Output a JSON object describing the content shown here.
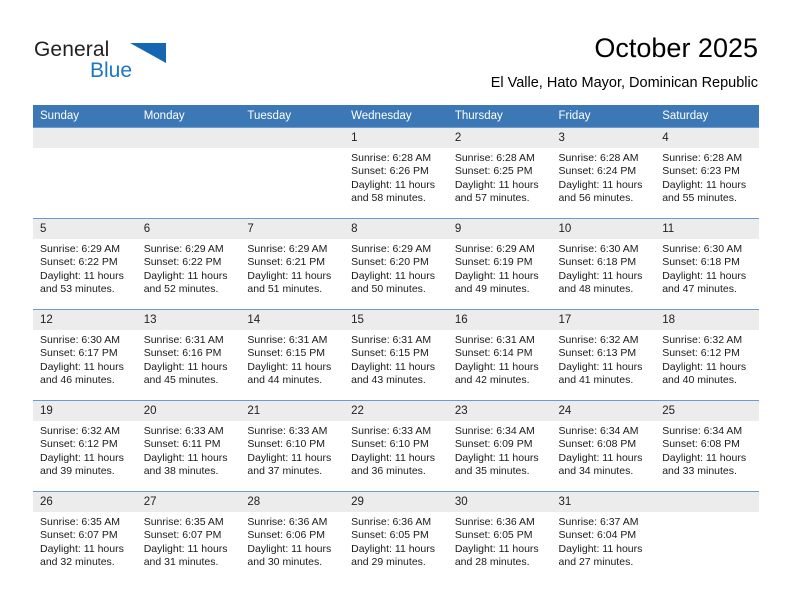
{
  "brand": {
    "name_part1": "General",
    "name_part2": "Blue"
  },
  "header": {
    "title": "October 2025",
    "subtitle": "El Valle, Hato Mayor, Dominican Republic"
  },
  "colors": {
    "header_blue": "#3b78b5",
    "brand_blue": "#1d76c4",
    "day_band": "#ececec",
    "row_rule": "#6b9bd0"
  },
  "weekday_headers": [
    "Sunday",
    "Monday",
    "Tuesday",
    "Wednesday",
    "Thursday",
    "Friday",
    "Saturday"
  ],
  "labels": {
    "sunrise_prefix": "Sunrise:",
    "sunset_prefix": "Sunset:",
    "daylight_prefix": "Daylight:"
  },
  "weeks": [
    [
      {
        "day": "",
        "empty": true
      },
      {
        "day": "",
        "empty": true
      },
      {
        "day": "",
        "empty": true
      },
      {
        "day": "1",
        "sunrise": "Sunrise: 6:28 AM",
        "sunset": "Sunset: 6:26 PM",
        "daylight_1": "Daylight: 11 hours",
        "daylight_2": "and 58 minutes."
      },
      {
        "day": "2",
        "sunrise": "Sunrise: 6:28 AM",
        "sunset": "Sunset: 6:25 PM",
        "daylight_1": "Daylight: 11 hours",
        "daylight_2": "and 57 minutes."
      },
      {
        "day": "3",
        "sunrise": "Sunrise: 6:28 AM",
        "sunset": "Sunset: 6:24 PM",
        "daylight_1": "Daylight: 11 hours",
        "daylight_2": "and 56 minutes."
      },
      {
        "day": "4",
        "sunrise": "Sunrise: 6:28 AM",
        "sunset": "Sunset: 6:23 PM",
        "daylight_1": "Daylight: 11 hours",
        "daylight_2": "and 55 minutes."
      }
    ],
    [
      {
        "day": "5",
        "sunrise": "Sunrise: 6:29 AM",
        "sunset": "Sunset: 6:22 PM",
        "daylight_1": "Daylight: 11 hours",
        "daylight_2": "and 53 minutes."
      },
      {
        "day": "6",
        "sunrise": "Sunrise: 6:29 AM",
        "sunset": "Sunset: 6:22 PM",
        "daylight_1": "Daylight: 11 hours",
        "daylight_2": "and 52 minutes."
      },
      {
        "day": "7",
        "sunrise": "Sunrise: 6:29 AM",
        "sunset": "Sunset: 6:21 PM",
        "daylight_1": "Daylight: 11 hours",
        "daylight_2": "and 51 minutes."
      },
      {
        "day": "8",
        "sunrise": "Sunrise: 6:29 AM",
        "sunset": "Sunset: 6:20 PM",
        "daylight_1": "Daylight: 11 hours",
        "daylight_2": "and 50 minutes."
      },
      {
        "day": "9",
        "sunrise": "Sunrise: 6:29 AM",
        "sunset": "Sunset: 6:19 PM",
        "daylight_1": "Daylight: 11 hours",
        "daylight_2": "and 49 minutes."
      },
      {
        "day": "10",
        "sunrise": "Sunrise: 6:30 AM",
        "sunset": "Sunset: 6:18 PM",
        "daylight_1": "Daylight: 11 hours",
        "daylight_2": "and 48 minutes."
      },
      {
        "day": "11",
        "sunrise": "Sunrise: 6:30 AM",
        "sunset": "Sunset: 6:18 PM",
        "daylight_1": "Daylight: 11 hours",
        "daylight_2": "and 47 minutes."
      }
    ],
    [
      {
        "day": "12",
        "sunrise": "Sunrise: 6:30 AM",
        "sunset": "Sunset: 6:17 PM",
        "daylight_1": "Daylight: 11 hours",
        "daylight_2": "and 46 minutes."
      },
      {
        "day": "13",
        "sunrise": "Sunrise: 6:31 AM",
        "sunset": "Sunset: 6:16 PM",
        "daylight_1": "Daylight: 11 hours",
        "daylight_2": "and 45 minutes."
      },
      {
        "day": "14",
        "sunrise": "Sunrise: 6:31 AM",
        "sunset": "Sunset: 6:15 PM",
        "daylight_1": "Daylight: 11 hours",
        "daylight_2": "and 44 minutes."
      },
      {
        "day": "15",
        "sunrise": "Sunrise: 6:31 AM",
        "sunset": "Sunset: 6:15 PM",
        "daylight_1": "Daylight: 11 hours",
        "daylight_2": "and 43 minutes."
      },
      {
        "day": "16",
        "sunrise": "Sunrise: 6:31 AM",
        "sunset": "Sunset: 6:14 PM",
        "daylight_1": "Daylight: 11 hours",
        "daylight_2": "and 42 minutes."
      },
      {
        "day": "17",
        "sunrise": "Sunrise: 6:32 AM",
        "sunset": "Sunset: 6:13 PM",
        "daylight_1": "Daylight: 11 hours",
        "daylight_2": "and 41 minutes."
      },
      {
        "day": "18",
        "sunrise": "Sunrise: 6:32 AM",
        "sunset": "Sunset: 6:12 PM",
        "daylight_1": "Daylight: 11 hours",
        "daylight_2": "and 40 minutes."
      }
    ],
    [
      {
        "day": "19",
        "sunrise": "Sunrise: 6:32 AM",
        "sunset": "Sunset: 6:12 PM",
        "daylight_1": "Daylight: 11 hours",
        "daylight_2": "and 39 minutes."
      },
      {
        "day": "20",
        "sunrise": "Sunrise: 6:33 AM",
        "sunset": "Sunset: 6:11 PM",
        "daylight_1": "Daylight: 11 hours",
        "daylight_2": "and 38 minutes."
      },
      {
        "day": "21",
        "sunrise": "Sunrise: 6:33 AM",
        "sunset": "Sunset: 6:10 PM",
        "daylight_1": "Daylight: 11 hours",
        "daylight_2": "and 37 minutes."
      },
      {
        "day": "22",
        "sunrise": "Sunrise: 6:33 AM",
        "sunset": "Sunset: 6:10 PM",
        "daylight_1": "Daylight: 11 hours",
        "daylight_2": "and 36 minutes."
      },
      {
        "day": "23",
        "sunrise": "Sunrise: 6:34 AM",
        "sunset": "Sunset: 6:09 PM",
        "daylight_1": "Daylight: 11 hours",
        "daylight_2": "and 35 minutes."
      },
      {
        "day": "24",
        "sunrise": "Sunrise: 6:34 AM",
        "sunset": "Sunset: 6:08 PM",
        "daylight_1": "Daylight: 11 hours",
        "daylight_2": "and 34 minutes."
      },
      {
        "day": "25",
        "sunrise": "Sunrise: 6:34 AM",
        "sunset": "Sunset: 6:08 PM",
        "daylight_1": "Daylight: 11 hours",
        "daylight_2": "and 33 minutes."
      }
    ],
    [
      {
        "day": "26",
        "sunrise": "Sunrise: 6:35 AM",
        "sunset": "Sunset: 6:07 PM",
        "daylight_1": "Daylight: 11 hours",
        "daylight_2": "and 32 minutes."
      },
      {
        "day": "27",
        "sunrise": "Sunrise: 6:35 AM",
        "sunset": "Sunset: 6:07 PM",
        "daylight_1": "Daylight: 11 hours",
        "daylight_2": "and 31 minutes."
      },
      {
        "day": "28",
        "sunrise": "Sunrise: 6:36 AM",
        "sunset": "Sunset: 6:06 PM",
        "daylight_1": "Daylight: 11 hours",
        "daylight_2": "and 30 minutes."
      },
      {
        "day": "29",
        "sunrise": "Sunrise: 6:36 AM",
        "sunset": "Sunset: 6:05 PM",
        "daylight_1": "Daylight: 11 hours",
        "daylight_2": "and 29 minutes."
      },
      {
        "day": "30",
        "sunrise": "Sunrise: 6:36 AM",
        "sunset": "Sunset: 6:05 PM",
        "daylight_1": "Daylight: 11 hours",
        "daylight_2": "and 28 minutes."
      },
      {
        "day": "31",
        "sunrise": "Sunrise: 6:37 AM",
        "sunset": "Sunset: 6:04 PM",
        "daylight_1": "Daylight: 11 hours",
        "daylight_2": "and 27 minutes."
      },
      {
        "day": "",
        "empty": true
      }
    ]
  ]
}
